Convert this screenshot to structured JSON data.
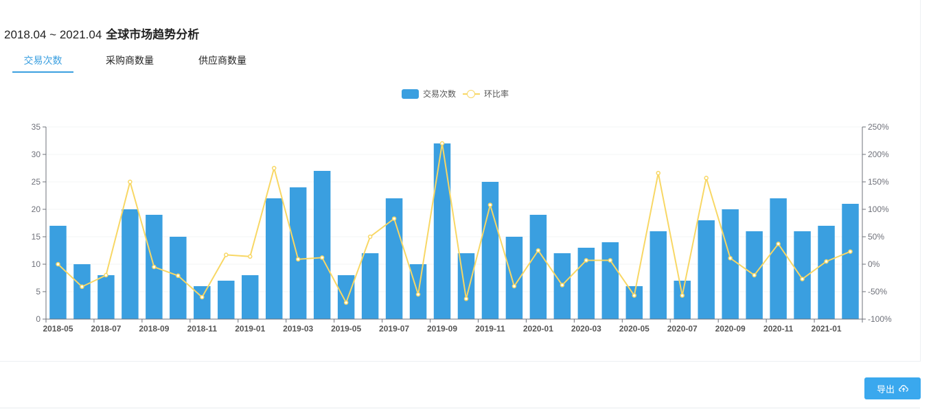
{
  "title": {
    "range": "2018.04 ~ 2021.04",
    "text": "全球市场趋势分析"
  },
  "tabs": [
    {
      "label": "交易次数",
      "active": true
    },
    {
      "label": "采购商数量",
      "active": false
    },
    {
      "label": "供应商数量",
      "active": false
    }
  ],
  "legend": {
    "bar_label": "交易次数",
    "line_label": "环比率"
  },
  "export": {
    "label": "导出",
    "icon": "cloud-upload-icon"
  },
  "colors": {
    "bar": "#3a9fe0",
    "line": "#f8d764",
    "accent": "#3a9fe0",
    "axis_text": "#6e7079"
  },
  "chart_data": {
    "type": "bar",
    "x": [
      "2018-05",
      "2018-06",
      "2018-07",
      "2018-08",
      "2018-09",
      "2018-10",
      "2018-11",
      "2018-12",
      "2019-01",
      "2019-02",
      "2019-03",
      "2019-04",
      "2019-05",
      "2019-06",
      "2019-07",
      "2019-08",
      "2019-09",
      "2019-10",
      "2019-11",
      "2019-12",
      "2020-01",
      "2020-02",
      "2020-03",
      "2020-04",
      "2020-05",
      "2020-06",
      "2020-07",
      "2020-08",
      "2020-09",
      "2020-10",
      "2020-11",
      "2020-12",
      "2021-01",
      "2021-02"
    ],
    "x_tick_labels": [
      "2018-05",
      "2018-07",
      "2018-09",
      "2018-11",
      "2019-01",
      "2019-03",
      "2019-05",
      "2019-07",
      "2019-09",
      "2019-11",
      "2020-01",
      "2020-03",
      "2020-05",
      "2020-07",
      "2020-09",
      "2020-11",
      "2021-01"
    ],
    "series": [
      {
        "name": "交易次数",
        "type": "bar",
        "axis": "left",
        "values": [
          17,
          10,
          8,
          20,
          19,
          15,
          6,
          7,
          8,
          22,
          24,
          27,
          8,
          12,
          22,
          10,
          32,
          12,
          25,
          15,
          19,
          12,
          13,
          14,
          6,
          16,
          7,
          18,
          20,
          16,
          22,
          16,
          17,
          21
        ]
      },
      {
        "name": "环比率",
        "type": "line",
        "axis": "right",
        "unit": "%",
        "values": [
          0,
          -41,
          -20,
          150,
          -5,
          -21,
          -60,
          17,
          14,
          175,
          9,
          12,
          -70,
          50,
          83,
          -55,
          220,
          -63,
          108,
          -40,
          25,
          -38,
          7,
          7,
          -57,
          166,
          -57,
          157,
          11,
          -20,
          37,
          -27,
          5,
          23
        ]
      }
    ],
    "y_left": {
      "min": 0,
      "max": 35,
      "ticks": [
        0,
        5,
        10,
        15,
        20,
        25,
        30,
        35
      ]
    },
    "y_right": {
      "min": -100,
      "max": 250,
      "ticks": [
        "-100%",
        "-50%",
        "0%",
        "50%",
        "100%",
        "150%",
        "200%",
        "250%"
      ]
    },
    "grid": true,
    "legend_position": "top-center"
  }
}
